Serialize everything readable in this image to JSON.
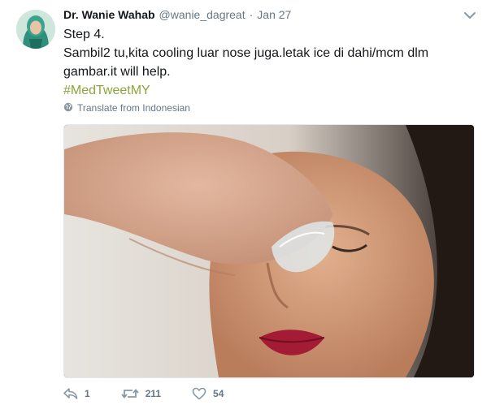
{
  "author": {
    "name": "Dr. Wanie Wahab",
    "handle": "@wanie_dagreat",
    "separator": "·",
    "date": "Jan 27"
  },
  "tweet": {
    "line1": "Step 4.",
    "line2": "Sambil2 tu,kita cooling luar nose juga.letak ice di dahi/mcm dlm gambar.it will help.",
    "hashtag": "#MedTweetMY",
    "translate_label": "Translate from Indonesian"
  },
  "actions": {
    "reply_count": "1",
    "retweet_count": "211",
    "like_count": "54"
  },
  "colors": {
    "hashtag": "#8ba53d",
    "muted": "#657786",
    "text": "#14171a"
  },
  "icons": [
    "reply-icon",
    "retweet-icon",
    "heart-icon",
    "globe-icon",
    "chevron-down-icon"
  ]
}
